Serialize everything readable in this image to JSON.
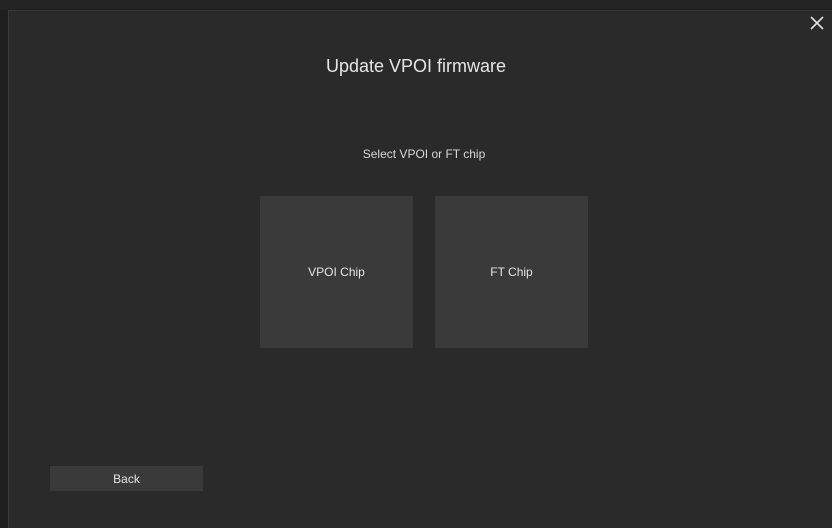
{
  "dialog": {
    "title": "Update VPOI firmware",
    "subtitle": "Select VPOI or FT chip",
    "close_icon": "close-icon"
  },
  "options": [
    {
      "label": "VPOI Chip"
    },
    {
      "label": "FT Chip"
    }
  ],
  "footer": {
    "back_label": "Back"
  },
  "colors": {
    "background": "#2a2a2a",
    "button": "#3a3a3a",
    "text": "#e4e4e4"
  }
}
